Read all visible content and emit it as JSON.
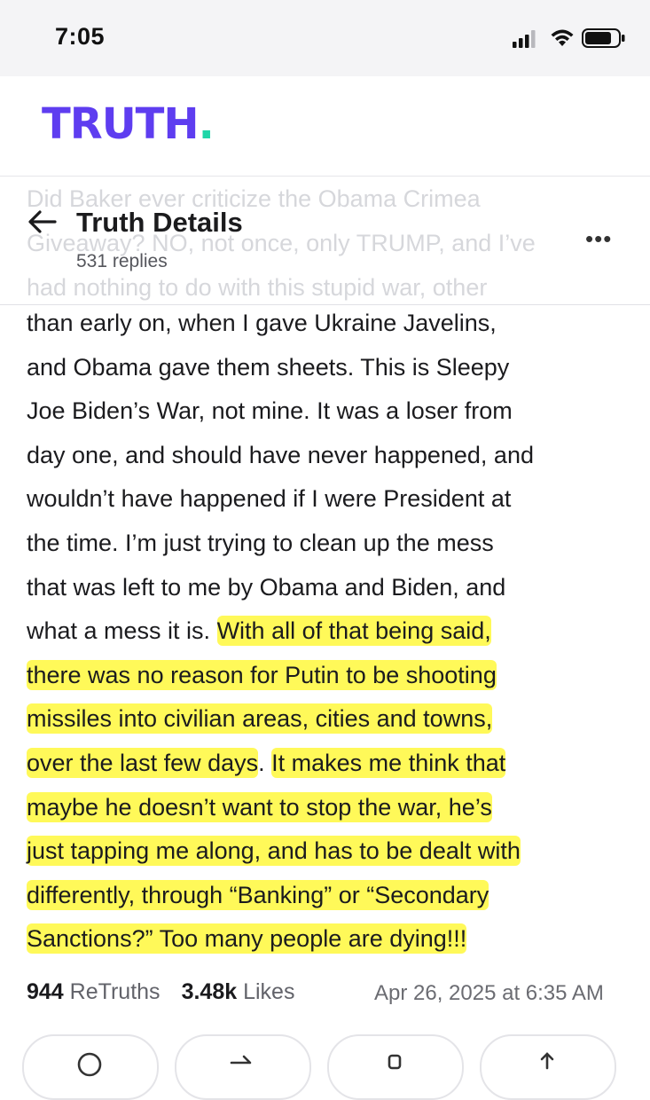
{
  "status_bar": {
    "time": "7:05"
  },
  "brand": {
    "name": "TRUTH",
    "dot": ".",
    "primary_color": "#5e3df0",
    "dot_color": "#1fd6a8"
  },
  "header": {
    "title": "Truth Details",
    "subtitle": "531 replies",
    "back_icon": "arrow-left-icon",
    "more_icon": "more-dots-icon",
    "more_label": "•••"
  },
  "faded_lines": [
    "Did Baker ever criticize the Obama Crimea",
    "Giveaway? NO, not once, only TRUMP, and I’ve",
    "had nothing to do with this stupid war, other"
  ],
  "post": {
    "lines": [
      [
        {
          "t": "than early on, when I gave Ukraine Javelins,",
          "h": false
        }
      ],
      [
        {
          "t": "and Obama gave them sheets. This is Sleepy",
          "h": false
        }
      ],
      [
        {
          "t": "Joe Biden’s War, not mine. It was a loser from",
          "h": false
        }
      ],
      [
        {
          "t": "day one, and should have never happened, and",
          "h": false
        }
      ],
      [
        {
          "t": "wouldn’t have happened if I were President at",
          "h": false
        }
      ],
      [
        {
          "t": "the time. I’m just trying to clean up the mess",
          "h": false
        }
      ],
      [
        {
          "t": "that was left to me by Obama and Biden, and",
          "h": false
        }
      ],
      [
        {
          "t": "what a mess it is. ",
          "h": false
        },
        {
          "t": "With all of that being said,",
          "h": true
        }
      ],
      [
        {
          "t": "there was no reason for Putin to be shooting",
          "h": true
        }
      ],
      [
        {
          "t": "missiles into civilian areas, cities and towns,",
          "h": true
        }
      ],
      [
        {
          "t": "over the last few days",
          "h": true
        },
        {
          "t": ". ",
          "h": false
        },
        {
          "t": "It makes me think that",
          "h": true
        }
      ],
      [
        {
          "t": "maybe he doesn’t want to stop the war, he’s",
          "h": true
        }
      ],
      [
        {
          "t": "just tapping me along, and has to be dealt with",
          "h": true
        }
      ],
      [
        {
          "t": "differently, through “Banking” or “Secondary",
          "h": true
        }
      ],
      [
        {
          "t": "Sanctions?” Too many people are dying!!!",
          "h": true
        }
      ]
    ],
    "highlight_color": "#fff83c"
  },
  "stats": {
    "retruths_count": "944",
    "retruths_label": "ReTruths",
    "likes_count": "3.48k",
    "likes_label": "Likes",
    "timestamp": "Apr 26, 2025 at 6:35 AM"
  },
  "actions": [
    {
      "icon": "reply-icon"
    },
    {
      "icon": "retruth-icon"
    },
    {
      "icon": "like-icon"
    },
    {
      "icon": "share-icon"
    }
  ]
}
